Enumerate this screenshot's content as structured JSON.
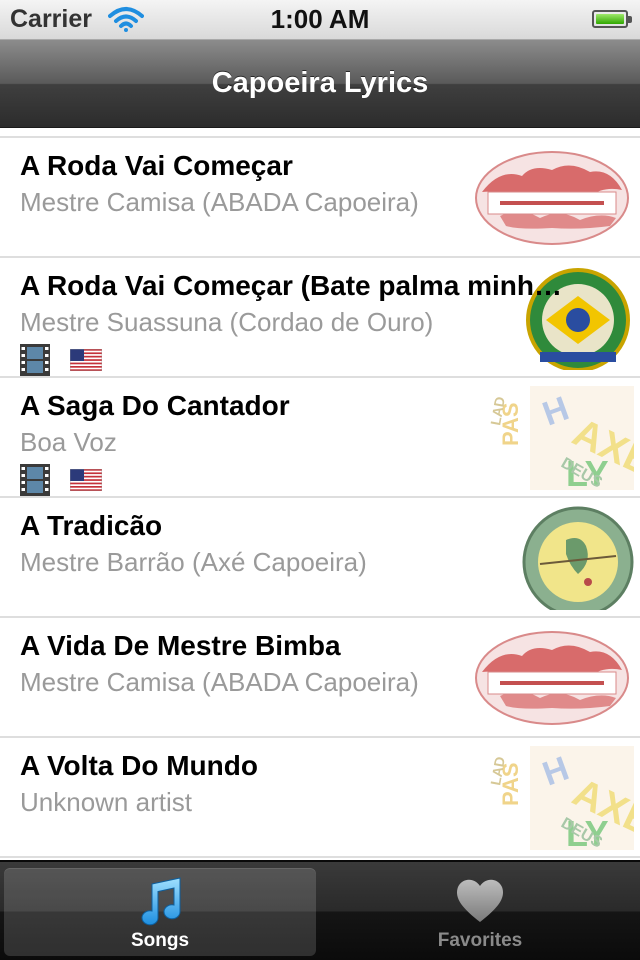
{
  "status_bar": {
    "carrier": "Carrier",
    "time": "1:00 AM",
    "battery_level": 1.0
  },
  "nav": {
    "title": "Capoeira Lyrics"
  },
  "songs": [
    {
      "title": "A Roda Vai Começar",
      "artist": "Mestre Camisa (ABADA Capoeira)",
      "thumbnail": "abada-logo",
      "has_video": false,
      "has_translation": false
    },
    {
      "title": "A Roda Vai Começar (Bate palma minh…",
      "artist": "Mestre Suassuna (Cordao de Ouro)",
      "thumbnail": "cordao-de-ouro-logo",
      "has_video": true,
      "has_translation": true
    },
    {
      "title": "A Saga Do Cantador",
      "artist": "Boa Voz",
      "thumbnail": "word-cloud",
      "has_video": true,
      "has_translation": true
    },
    {
      "title": "A Tradicão",
      "artist": "Mestre Barrão (Axé Capoeira)",
      "thumbnail": "axe-capoeira-logo",
      "has_video": false,
      "has_translation": false
    },
    {
      "title": "A Vida De Mestre Bimba",
      "artist": "Mestre Camisa (ABADA Capoeira)",
      "thumbnail": "abada-logo",
      "has_video": false,
      "has_translation": false
    },
    {
      "title": "A Volta Do Mundo",
      "artist": "Unknown artist",
      "thumbnail": "word-cloud",
      "has_video": false,
      "has_translation": false
    }
  ],
  "tabs": [
    {
      "label": "Songs",
      "icon": "music-note-icon",
      "active": true
    },
    {
      "label": "Favorites",
      "icon": "heart-icon",
      "active": false
    }
  ],
  "colors": {
    "accent_blue": "#2fa7ea",
    "subtitle_gray": "#9a9a9a",
    "battery_green": "#2fa700"
  }
}
